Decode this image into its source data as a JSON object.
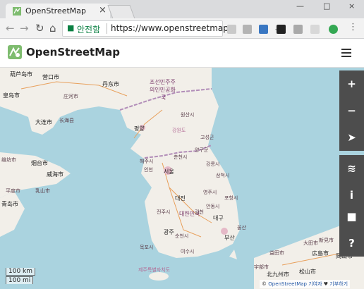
{
  "browser": {
    "tab_title": "OpenStreetMap",
    "tab_close": "×",
    "window_controls": [
      "—",
      "□",
      "×"
    ],
    "secure_label": "안전함",
    "url": "https://www.openstreetmap...",
    "nav_icons": [
      "back-icon",
      "forward-icon",
      "reload-icon",
      "home-icon"
    ]
  },
  "app": {
    "title": "OpenStreetMap",
    "menu_icon": "hamburger-menu-icon"
  },
  "map_controls": {
    "zoom_in": "+",
    "zoom_out": "−",
    "locate": "➤",
    "layers": "≋",
    "info": "i",
    "share": "↗",
    "note": "■",
    "query": "?"
  },
  "map_labels": {
    "c1": "葫芦岛市",
    "c2": "营口市",
    "c3": "丹东市",
    "c4": "조선민주주",
    "c5": "의인민공화",
    "c6": "국",
    "c7": "皇岛市",
    "c8": "庄河市",
    "c9": "大连市",
    "c10": "长海县",
    "c11": "평양",
    "c12": "원산시",
    "c13": "강원도",
    "c14": "고성군",
    "c15": "춘천시",
    "c16": "서울",
    "c17": "양구군",
    "c18": "강릉시",
    "c19": "삼척시",
    "c20": "대전",
    "c21": "대한민국",
    "c22": "대구",
    "c23": "광주",
    "c24": "부산",
    "c25": "烟台市",
    "c26": "威海市",
    "c27": "青岛市",
    "c28": "乳山市",
    "c29": "平度市",
    "c30": "维坊市",
    "c31": "울산",
    "c32": "포항시",
    "c33": "여수시",
    "c34": "목포시",
    "c35": "제주특별자치도",
    "c36": "益田市",
    "c37": "大田市",
    "c38": "広島市",
    "c39": "新見市",
    "c40": "岡山市",
    "c41": "北九州市",
    "c42": "松山市",
    "c43": "宇部市",
    "c44": "해주시",
    "c45": "영주시",
    "c46": "안동시",
    "c47": "전주시",
    "c48": "인천",
    "c49": "김천",
    "c50": "순천시"
  },
  "scale": {
    "km": "100 km",
    "mi": "100 mi"
  },
  "attribution": {
    "prefix": "©",
    "link": "OpenStreetMap",
    "contributors": "기여자",
    "heart": "♥",
    "donate": "기부하기"
  },
  "colors": {
    "water": "#aad3df",
    "land": "#f2efe9",
    "control_bg": "#4d4d4d",
    "accent": "#7ebc6f",
    "secure": "#0b8043"
  }
}
